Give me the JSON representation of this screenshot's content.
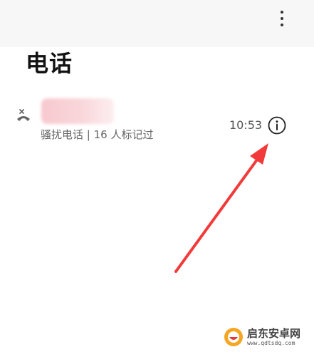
{
  "header": {
    "title": "电话",
    "more_icon": "more-vertical-icon"
  },
  "call_log": [
    {
      "type_icon": "missed-call-icon",
      "description": "骚扰电话 | 16 人标记过",
      "time": "10:53",
      "action_icon": "info-icon"
    }
  ],
  "watermark": {
    "name": "启东安卓网",
    "url": "www.qdtsdq.com"
  },
  "colors": {
    "annotation_arrow": "#f23a3a",
    "redacted_name": "#f7c9cf",
    "watermark_logo": "#f5a623"
  }
}
